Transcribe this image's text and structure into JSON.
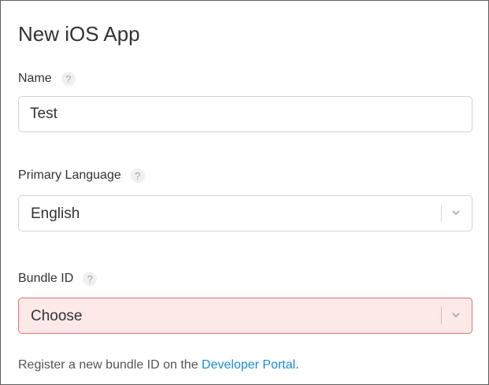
{
  "title": "New iOS App",
  "name_field": {
    "label": "Name",
    "help": "?",
    "value": "Test"
  },
  "language_field": {
    "label": "Primary Language",
    "help": "?",
    "value": "English"
  },
  "bundle_field": {
    "label": "Bundle ID",
    "help": "?",
    "value": "Choose",
    "state": "error"
  },
  "helper": {
    "prefix": "Register a new bundle ID on the ",
    "link_text": "Developer Portal",
    "suffix": "."
  },
  "colors": {
    "error_border": "#e5746e",
    "error_background": "#fde9e8",
    "link": "#1a8bd8"
  },
  "icons": {
    "help": "question-circle-icon",
    "dropdown": "chevron-down-icon"
  }
}
